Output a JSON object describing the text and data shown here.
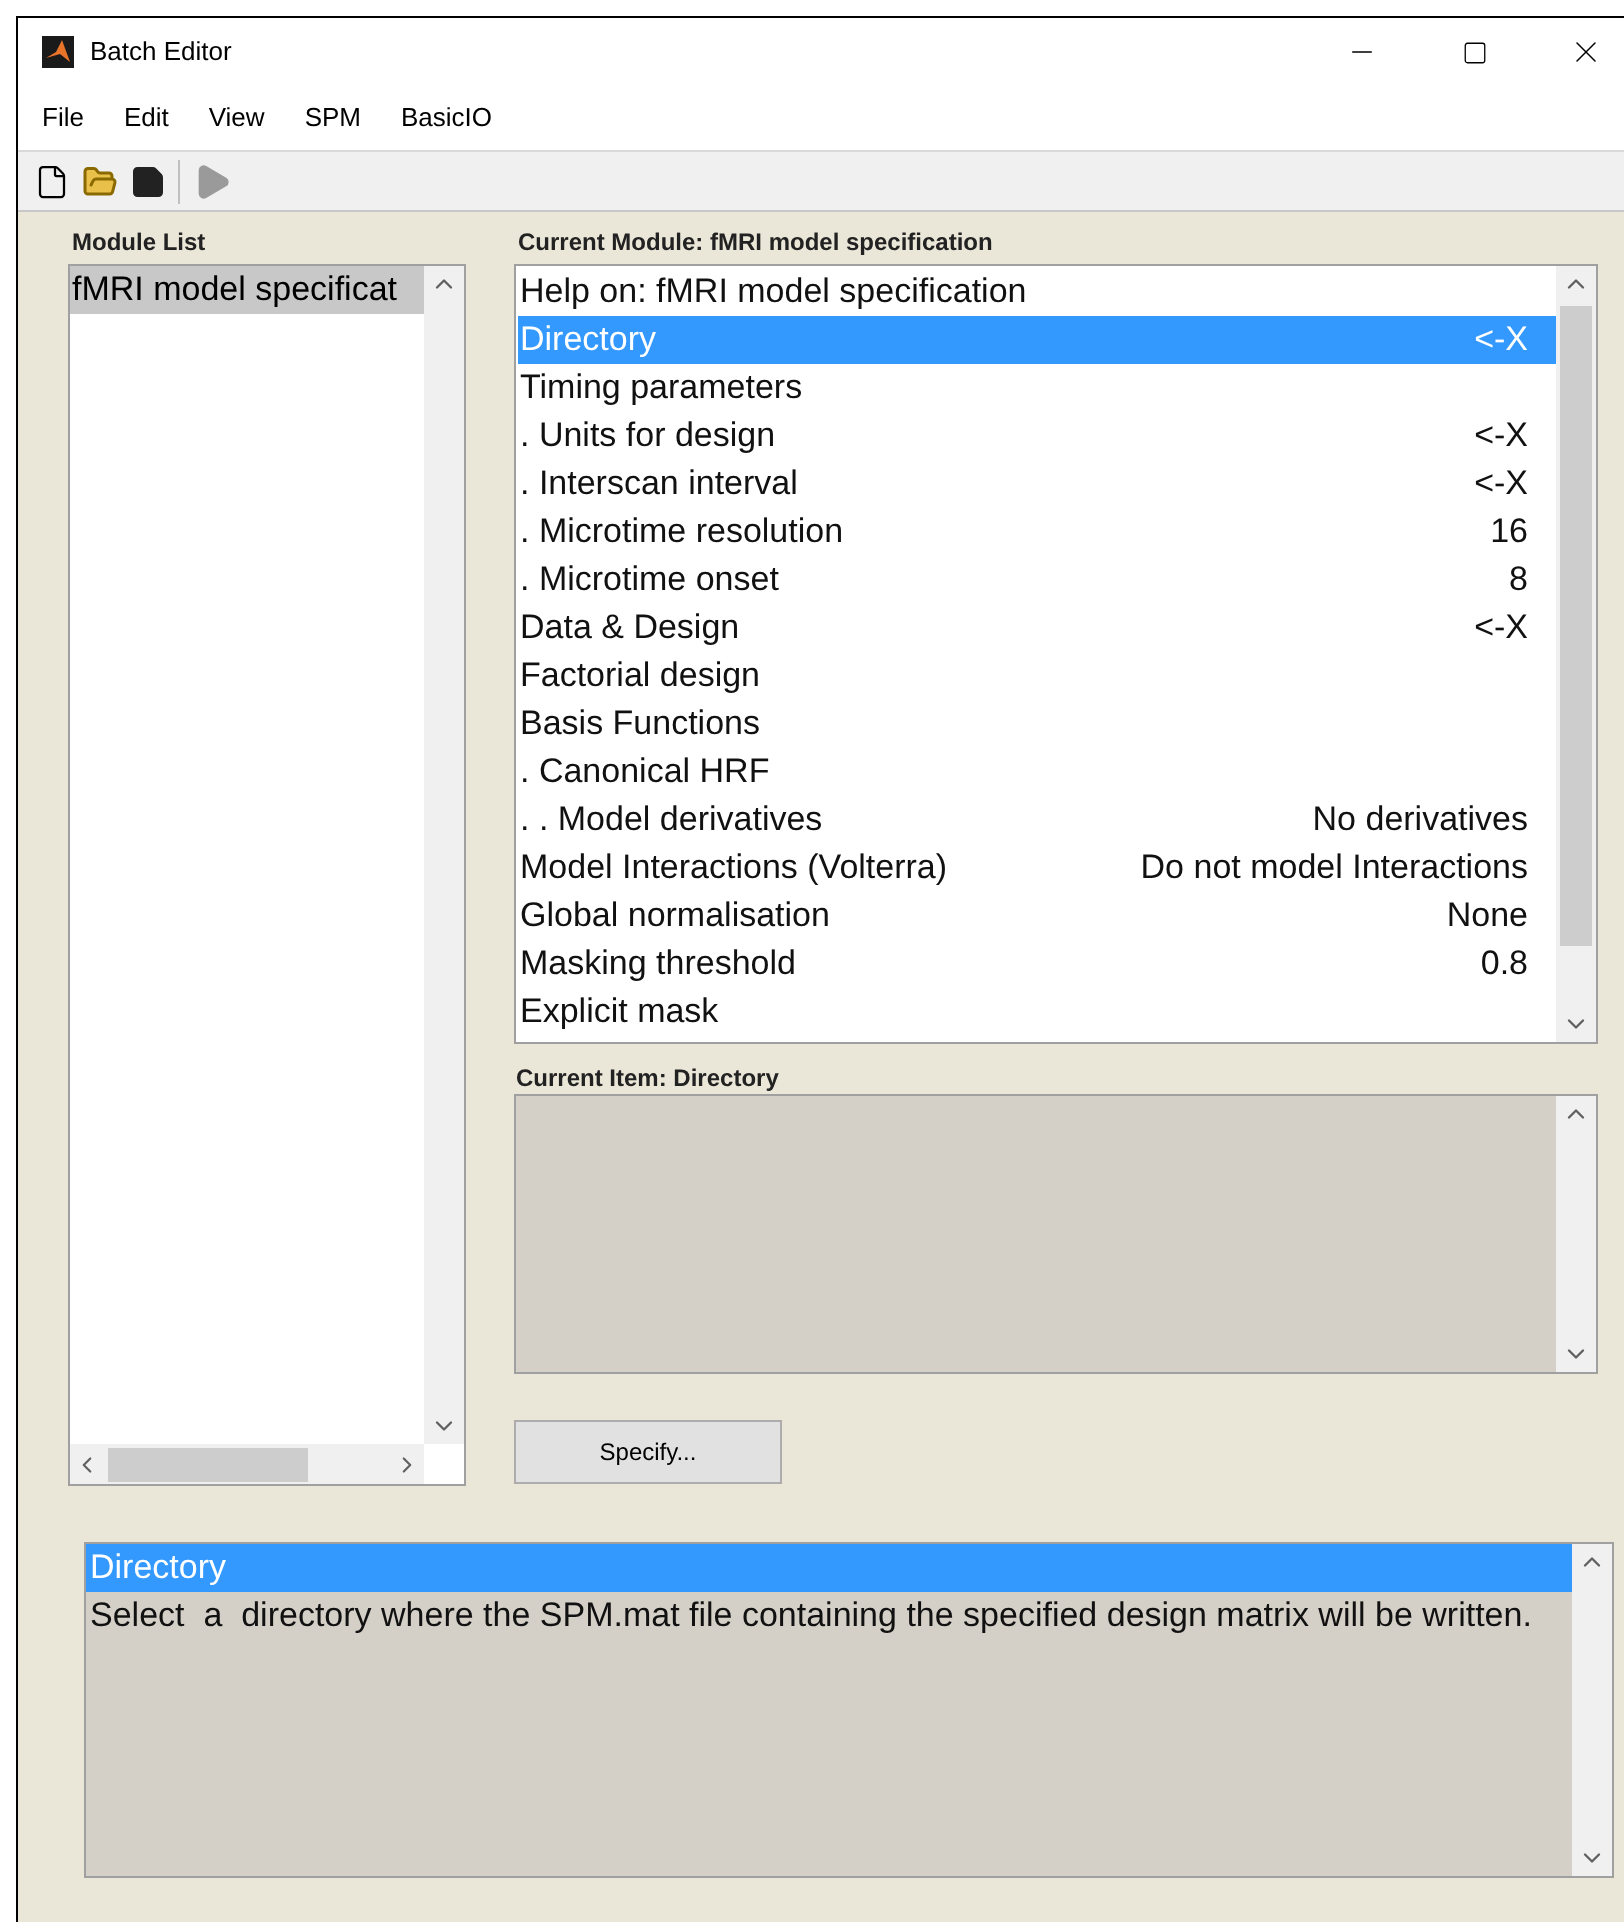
{
  "window": {
    "title": "Batch Editor"
  },
  "menu": [
    "File",
    "Edit",
    "View",
    "SPM",
    "BasicIO"
  ],
  "module_list": {
    "label": "Module List",
    "items": [
      {
        "name": "fMRI model specificat",
        "selected": true
      }
    ]
  },
  "current_module": {
    "label": "Current Module: fMRI model specification",
    "rows": [
      {
        "name": "Help on: fMRI model specification",
        "value": "",
        "selected": false
      },
      {
        "name": "Directory",
        "value": "<-X",
        "selected": true
      },
      {
        "name": "Timing parameters",
        "value": "",
        "selected": false
      },
      {
        "name": ". Units for design",
        "value": "<-X",
        "selected": false
      },
      {
        "name": ". Interscan interval",
        "value": "<-X",
        "selected": false
      },
      {
        "name": ". Microtime resolution",
        "value": "16",
        "selected": false
      },
      {
        "name": ". Microtime onset",
        "value": "8",
        "selected": false
      },
      {
        "name": "Data & Design",
        "value": "<-X",
        "selected": false
      },
      {
        "name": "Factorial design",
        "value": "",
        "selected": false
      },
      {
        "name": "Basis Functions",
        "value": "",
        "selected": false
      },
      {
        "name": ". Canonical HRF",
        "value": "",
        "selected": false
      },
      {
        "name": ". . Model derivatives",
        "value": "No derivatives",
        "selected": false
      },
      {
        "name": "Model Interactions (Volterra)",
        "value": "Do not model Interactions",
        "selected": false
      },
      {
        "name": "Global normalisation",
        "value": "None",
        "selected": false
      },
      {
        "name": "Masking threshold",
        "value": "0.8",
        "selected": false
      },
      {
        "name": "Explicit mask",
        "value": "",
        "selected": false
      }
    ]
  },
  "current_item": {
    "label": "Current Item: Directory"
  },
  "specify_button": "Specify...",
  "help": {
    "title": "Directory",
    "text": "Select  a  directory where the SPM.mat file containing the specified design matrix will be written."
  }
}
